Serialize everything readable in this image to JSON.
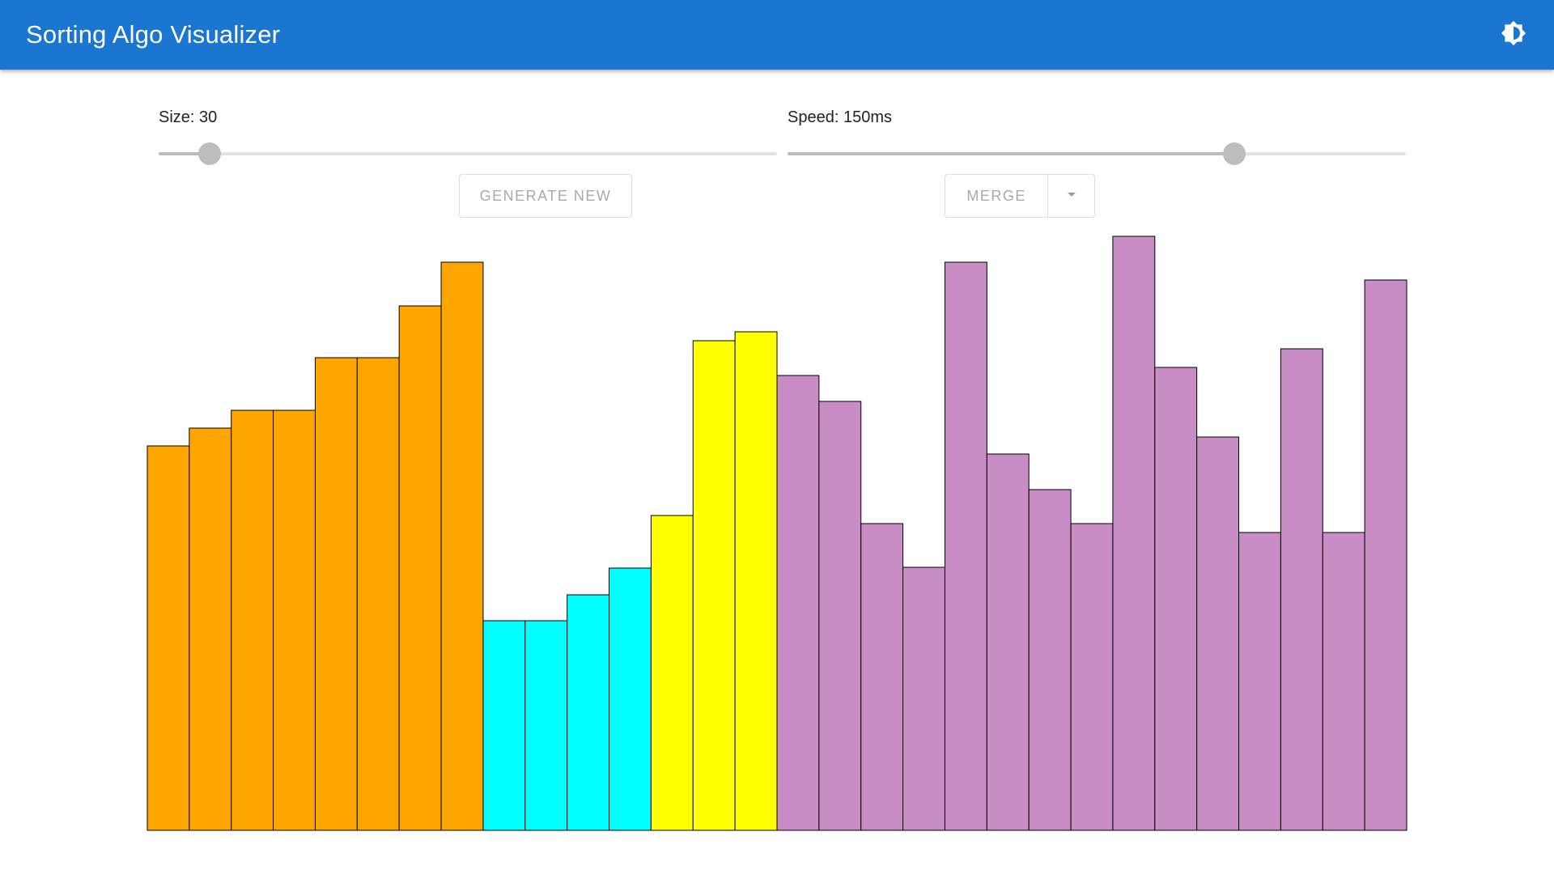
{
  "app": {
    "title": "Sorting Algo Visualizer",
    "theme_icon": "brightness-icon"
  },
  "controls": {
    "size": {
      "label": "Size: 30",
      "value": 30,
      "fraction": 0.083
    },
    "speed": {
      "label": "Speed: 150ms",
      "value": 150,
      "fraction": 0.722
    },
    "generate_label": "GENERATE NEW",
    "algorithm_label": "MERGE",
    "dropdown_icon": "arrow-drop-down-icon"
  },
  "colors": {
    "appbar": "#1b76d2",
    "sorted": "#ffa500",
    "left_half": "#00ffff",
    "right_half": "#ffff00",
    "unsorted": "#c98dc6",
    "bar_border": "#000000",
    "slider": "#bdbdbd"
  },
  "chart_data": {
    "type": "bar",
    "max": 735,
    "values": [
      475,
      497,
      519,
      519,
      584,
      584,
      648,
      702,
      259,
      259,
      291,
      324,
      389,
      605,
      616,
      562,
      530,
      379,
      325,
      702,
      465,
      421,
      379,
      734,
      572,
      486,
      368,
      595,
      368,
      680
    ],
    "states": [
      "sorted",
      "sorted",
      "sorted",
      "sorted",
      "sorted",
      "sorted",
      "sorted",
      "sorted",
      "left_half",
      "left_half",
      "left_half",
      "left_half",
      "right_half",
      "right_half",
      "right_half",
      "unsorted",
      "unsorted",
      "unsorted",
      "unsorted",
      "unsorted",
      "unsorted",
      "unsorted",
      "unsorted",
      "unsorted",
      "unsorted",
      "unsorted",
      "unsorted",
      "unsorted",
      "unsorted",
      "unsorted"
    ]
  }
}
